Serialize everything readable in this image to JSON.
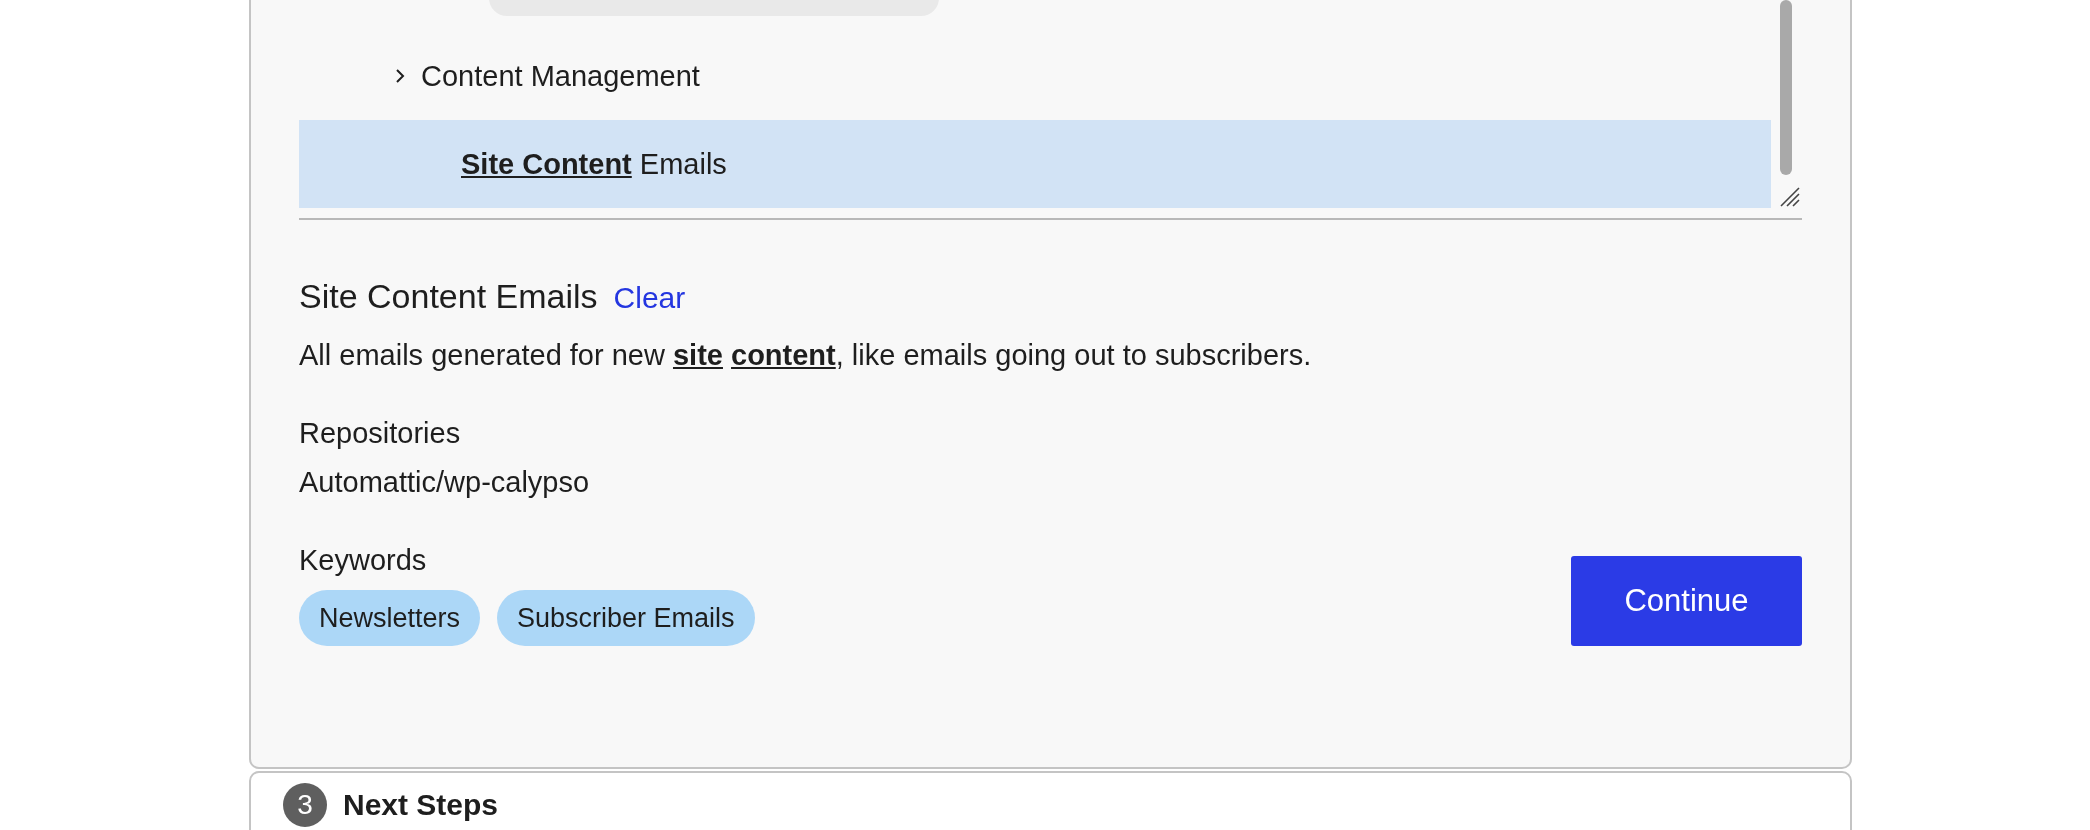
{
  "tree": {
    "items": [
      {
        "label": "Content Management",
        "selected": false,
        "children": [
          {
            "label": "**Site Content** Emails",
            "selected": true
          }
        ]
      }
    ]
  },
  "feature": {
    "title": "Site Content Emails",
    "clear_link": "Clear",
    "description": "All emails generated for new **site** **content**, like emails going out to subscribers.",
    "repositories_label": "Repositories",
    "repositories": [
      "Automattic/wp-calypso"
    ],
    "keywords_label": "Keywords",
    "keywords": [
      "Newsletters",
      "Subscriber Emails"
    ]
  },
  "continue_button": "Continue",
  "next_step": {
    "number": "3",
    "title": "Next Steps"
  }
}
